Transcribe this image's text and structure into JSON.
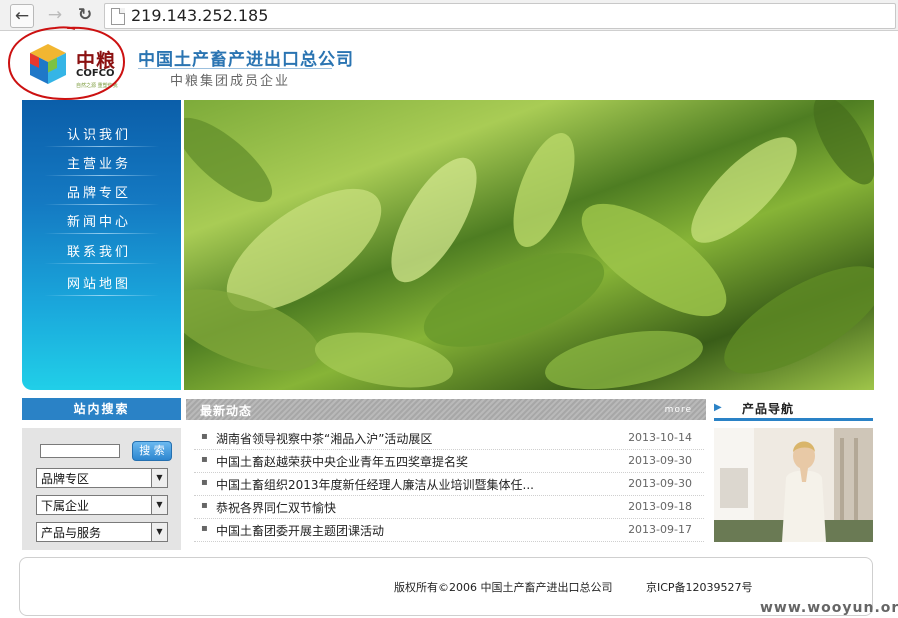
{
  "browser": {
    "url": "219.143.252.185",
    "back_glyph": "←",
    "forward_glyph": "→",
    "reload_glyph": "↻"
  },
  "header": {
    "logo_cn": "中粮",
    "logo_en": "COFCO",
    "logo_tag": "自然之源 重塑你我",
    "company_name": "中国土产畜产进出口总公司",
    "company_sub": "中粮集团成员企业",
    "annotation_color": "#cc1111"
  },
  "menu": {
    "items": [
      {
        "label": "认识我们"
      },
      {
        "label": "主营业务"
      },
      {
        "label": "品牌专区"
      },
      {
        "label": "新闻中心"
      },
      {
        "label": "联系我们"
      },
      {
        "label": "网站地图"
      }
    ]
  },
  "search": {
    "title": "站内搜索",
    "input_value": "",
    "button_label": "搜 索",
    "selects": [
      {
        "value": "品牌专区"
      },
      {
        "value": "下属企业"
      },
      {
        "value": "产品与服务"
      }
    ],
    "dropdown_glyph": "▼"
  },
  "news": {
    "title": "最新动态",
    "more": "more",
    "bullet": "▪",
    "items": [
      {
        "title": "湖南省领导视察中茶“湘品入沪”活动展区",
        "date": "2013-10-14"
      },
      {
        "title": "中国土畜赵越荣获中央企业青年五四奖章提名奖",
        "date": "2013-09-30"
      },
      {
        "title": "中国土畜组织2013年度新任经理人廉洁从业培训暨集体任...",
        "date": "2013-09-30"
      },
      {
        "title": "恭祝各界同仁双节愉快",
        "date": "2013-09-18"
      },
      {
        "title": "中国土畜团委开展主题团课活动",
        "date": "2013-09-17"
      }
    ]
  },
  "products": {
    "title": "产品导航",
    "arrow": "▶"
  },
  "footer": {
    "copyright": "版权所有©2006 中国土产畜产进出口总公司",
    "icp": "京ICP备12039527号"
  },
  "watermark": "www.wooyun.org",
  "colors": {
    "brand_blue": "#2a82c6",
    "menu_top": "#0b5ea9",
    "menu_bottom": "#21cfe8",
    "logo_red": "#8b1111"
  }
}
